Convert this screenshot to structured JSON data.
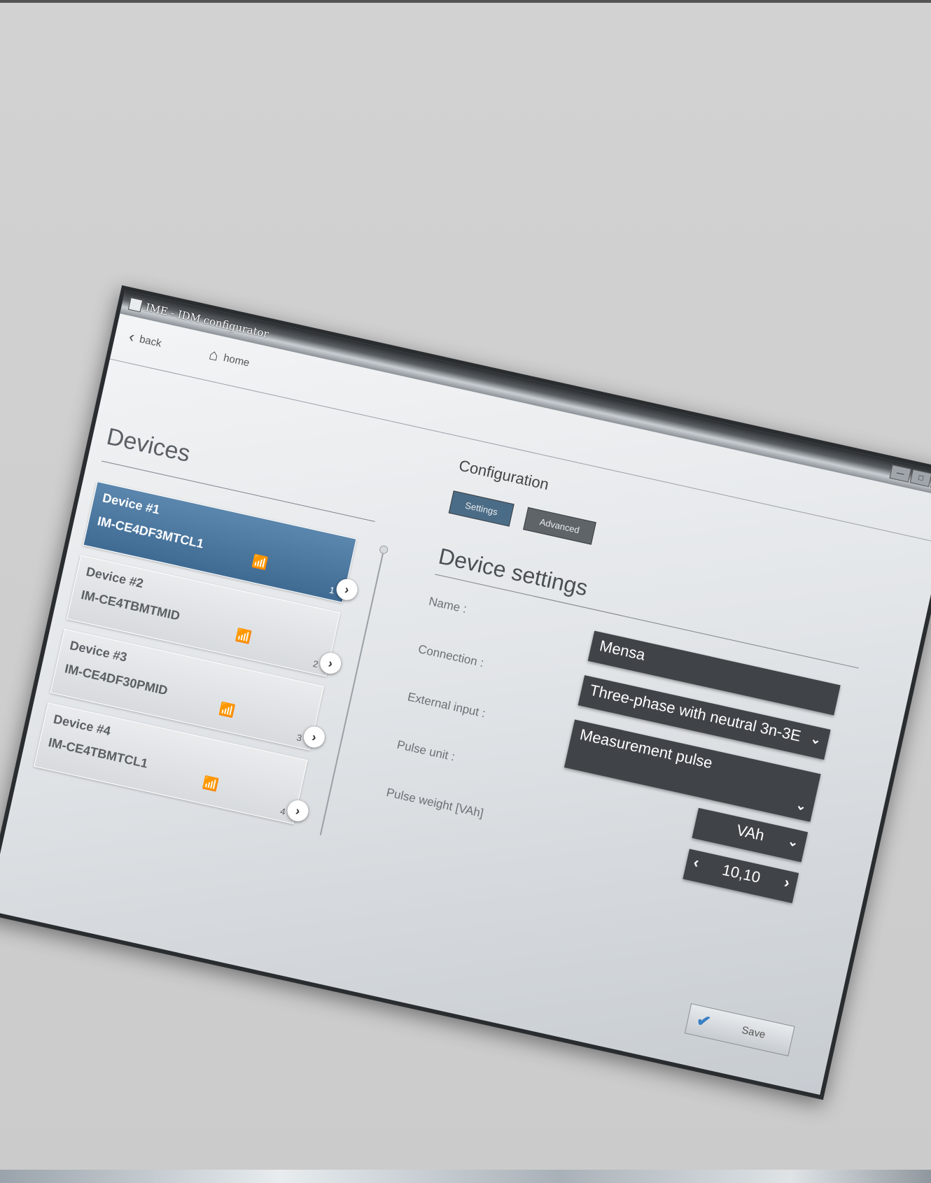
{
  "window": {
    "title": "IME - IDM configurator",
    "controls": [
      "—",
      "□",
      "✕"
    ]
  },
  "nav": {
    "back_label": "back",
    "home_label": "home"
  },
  "screen_title": "Configuration",
  "devices": {
    "title": "Devices",
    "items": [
      {
        "name": "Device #1",
        "id": "IM-CE4DF3MTCL1",
        "index": "1",
        "active": true
      },
      {
        "name": "Device #2",
        "id": "IM-CE4TBMTMID",
        "index": "2",
        "active": false
      },
      {
        "name": "Device #3",
        "id": "IM-CE4DF30PMID",
        "index": "3",
        "active": false
      },
      {
        "name": "Device #4",
        "id": "IM-CE4TBMTCL1",
        "index": "4",
        "active": false
      }
    ]
  },
  "tabs": {
    "settings": "Settings",
    "advanced": "Advanced"
  },
  "settings": {
    "title": "Device settings",
    "labels": {
      "name": "Name :",
      "connection": "Connection :",
      "external_input": "External input :",
      "pulse_unit": "Pulse unit :",
      "pulse_weight": "Pulse weight [VAh]"
    },
    "values": {
      "name": "Mensa",
      "connection": "Three-phase with neutral 3n-3E",
      "external_input": "Measurement pulse",
      "pulse_unit": "VAh",
      "pulse_weight": "10,10"
    }
  },
  "save_label": "Save",
  "icons": {
    "back": "‹",
    "home": "⌂",
    "wifi": "📶",
    "arrow": "›",
    "chevron": "⌄",
    "check": "✔"
  },
  "colors": {
    "active_card": "#4b7aa3",
    "control_bg": "#404448",
    "accent_check": "#3a7fc4"
  }
}
